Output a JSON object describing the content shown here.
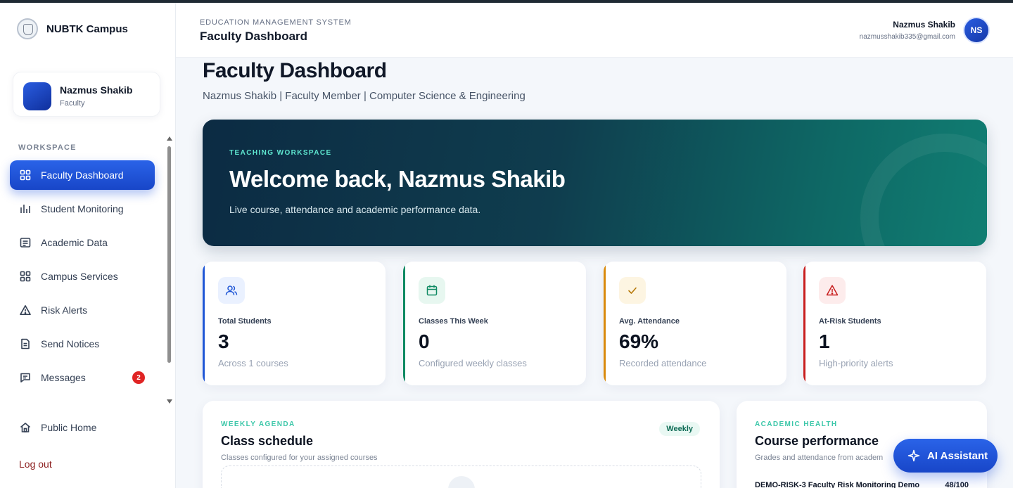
{
  "brand": {
    "name": "NUBTK Campus"
  },
  "profile": {
    "name": "Nazmus Shakib",
    "role": "Faculty"
  },
  "sidebar": {
    "section_label": "WORKSPACE",
    "items": [
      {
        "label": "Faculty Dashboard",
        "icon": "grid-icon",
        "active": true
      },
      {
        "label": "Student Monitoring",
        "icon": "bar-chart-icon"
      },
      {
        "label": "Academic Data",
        "icon": "document-list-icon"
      },
      {
        "label": "Campus Services",
        "icon": "grid-icon"
      },
      {
        "label": "Risk Alerts",
        "icon": "warning-icon"
      },
      {
        "label": "Send Notices",
        "icon": "file-text-icon"
      },
      {
        "label": "Messages",
        "icon": "message-icon",
        "badge": "2"
      }
    ],
    "public_home": "Public Home",
    "logout": "Log out"
  },
  "header": {
    "subtitle": "EDUCATION MANAGEMENT SYSTEM",
    "title": "Faculty Dashboard",
    "user_name": "Nazmus Shakib",
    "user_email": "nazmusshakib335@gmail.com",
    "avatar_initials": "NS"
  },
  "main": {
    "title": "Faculty Dashboard",
    "meta": "Nazmus Shakib | Faculty Member | Computer Science & Engineering",
    "hero": {
      "kicker": "TEACHING WORKSPACE",
      "title": "Welcome back, Nazmus Shakib",
      "description": "Live course, attendance and academic performance data."
    },
    "stats": [
      {
        "label": "Total Students",
        "value": "3",
        "sub": "Across 1 courses",
        "accent": "#1f56d6",
        "icon": "users-icon"
      },
      {
        "label": "Classes This Week",
        "value": "0",
        "sub": "Configured weekly classes",
        "accent": "#0f8a63",
        "icon": "calendar-icon"
      },
      {
        "label": "Avg. Attendance",
        "value": "69%",
        "sub": "Recorded attendance",
        "accent": "#d98a0b",
        "icon": "check-icon"
      },
      {
        "label": "At-Risk Students",
        "value": "1",
        "sub": "High-priority alerts",
        "accent": "#c81e1e",
        "icon": "alert-icon"
      }
    ],
    "schedule": {
      "kicker": "WEEKLY AGENDA",
      "title": "Class schedule",
      "description": "Classes configured for your assigned courses",
      "pill": "Weekly"
    },
    "performance": {
      "kicker": "ACADEMIC HEALTH",
      "title": "Course performance",
      "description": "Grades and attendance from academ",
      "row_label": "DEMO-RISK-3 Faculty Risk Monitoring Demo",
      "row_value": "48/100"
    }
  },
  "ai_assistant": {
    "label": "AI Assistant"
  }
}
